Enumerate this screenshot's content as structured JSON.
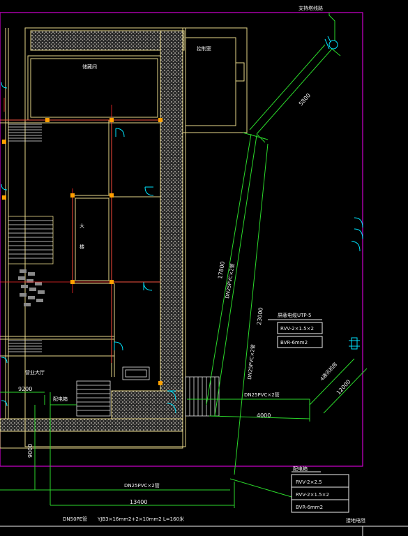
{
  "drawing": {
    "labels": {
      "top_right_note": "支持塔线路",
      "room_top": "控制室",
      "room_kitchen": "储藏间",
      "room_lower_left": "营业大厅",
      "stair_char_1": "大",
      "stair_char_2": "楼",
      "bottom_right_title": "接地电阻"
    },
    "dimensions": {
      "d5800": "5800",
      "d17800": "17800",
      "d23000": "23000",
      "d4000": "4000",
      "d12000": "12000",
      "d9200": "9200",
      "d9000": "9000",
      "d13400": "13400"
    },
    "cables": {
      "dn25_a": "DN25PVC×2管",
      "dn25_b": "DN25PVC×2管",
      "dn25_c": "DN25PVC×2管",
      "dn25_d": "DN25PVC×2管",
      "dn50": "DN50PE管",
      "yjb": "YJB3×16mm2+2×10mm2   L=160米"
    },
    "legend_upper": {
      "title": "屏蔽电缆UTP-5",
      "rows": [
        "RVV-2×1.5×2",
        "BVR-6mm2"
      ]
    },
    "legend_lower": {
      "title": "配电箱",
      "rows": [
        "RVV-2×2.5",
        "RVV-2×1.5×2",
        "BVR-6mm2"
      ]
    },
    "misc": {
      "distribution_box": "配电箱",
      "access_label": "4通讯机房"
    }
  },
  "colors": {
    "background": "#000000",
    "wall": "#e8d88a",
    "wall_fill": "#bdb9b0",
    "cyan": "#00e5ff",
    "green": "#2bd92b",
    "white": "#f0f0f0",
    "red": "#ff2a2a",
    "magenta": "#d000d0",
    "orange": "#ffa000"
  }
}
